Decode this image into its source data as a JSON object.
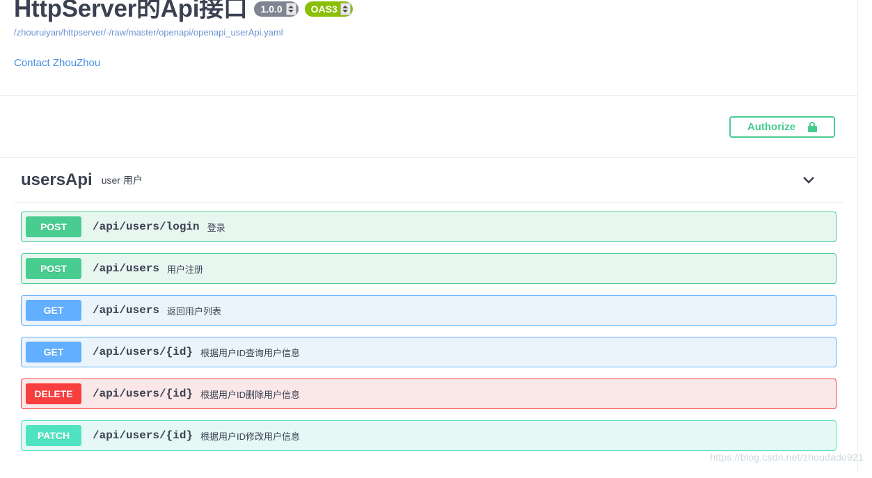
{
  "header": {
    "title": "HttpServer的Api接口",
    "version_badge": "1.0.0",
    "oas_badge": "OAS3",
    "spec_url": "/zhouruiyan/httpserver/-/raw/master/openapi/openapi_userApi.yaml",
    "contact_link": "Contact ZhouZhou"
  },
  "auth": {
    "authorize_label": "Authorize",
    "lock_icon": "lock-closed-icon"
  },
  "tag": {
    "name": "usersApi",
    "description": "user 用户",
    "toggle_icon": "chevron-down-icon"
  },
  "operations": [
    {
      "method": "POST",
      "path": "/api/users/login",
      "summary": "登录",
      "style": "post"
    },
    {
      "method": "POST",
      "path": "/api/users",
      "summary": "用户注册",
      "style": "post"
    },
    {
      "method": "GET",
      "path": "/api/users",
      "summary": "返回用户列表",
      "style": "get"
    },
    {
      "method": "GET",
      "path": "/api/users/{id}",
      "summary": "根据用户ID查询用户信息",
      "style": "get"
    },
    {
      "method": "DELETE",
      "path": "/api/users/{id}",
      "summary": "根据用户ID删除用户信息",
      "style": "delete"
    },
    {
      "method": "PATCH",
      "path": "/api/users/{id}",
      "summary": "根据用户ID修改用户信息",
      "style": "patch"
    }
  ],
  "watermark": "https://blog.csdn.net/zhoudado921",
  "colors": {
    "post": "#49cc90",
    "get": "#61affe",
    "delete": "#f93e3e",
    "patch": "#50e3c2",
    "oas": "#89bf04",
    "version": "#7d8492",
    "link": "#4990e2",
    "text": "#3b4151"
  }
}
